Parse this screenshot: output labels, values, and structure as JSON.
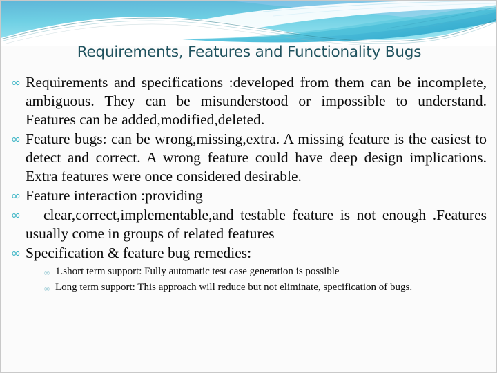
{
  "slide": {
    "title": "Requirements, Features and Functionality Bugs",
    "bullet_glyph_level1": "∞",
    "bullet_glyph_level2": "∞",
    "colors": {
      "title": "#1f525e",
      "bullet_level1": "#3fb6c6",
      "bullet_level2": "#9dccd6",
      "banner_cyan_light": "#a8e4f0",
      "banner_cyan_mid": "#4ec3dc",
      "banner_cyan_dark": "#2fa9c8",
      "banner_blue_top": "#7fc4e8",
      "background": "#fbfbfb",
      "body_text": "#0b0b0b"
    },
    "bullets": [
      {
        "level": 1,
        "text": "Requirements and specifications :developed from them can be incomplete, ambiguous. They can be misunderstood or impossible to understand. Features can be added,modified,deleted.",
        "justify": true
      },
      {
        "level": 1,
        "text": "Feature bugs: can be wrong,missing,extra. A  missing feature is the easiest  to detect and correct. A wrong feature could have deep design implications. Extra features were once considered desirable.",
        "justify": true
      },
      {
        "level": 1,
        "text": "Feature interaction :providing",
        "justify": false
      },
      {
        "level": 1,
        "text": "clear,correct,implementable,and testable feature is not enough .Features usually come in groups of related features",
        "justify": true,
        "indent_first": true
      },
      {
        "level": 1,
        "text": "Specification & feature bug remedies:",
        "justify": false
      },
      {
        "level": 2,
        "text": "1.short term support: Fully automatic test case generation is possible",
        "justify": false
      },
      {
        "level": 2,
        "text": "Long term support: This approach   will reduce but not eliminate, specification of bugs.",
        "justify": true
      }
    ]
  }
}
